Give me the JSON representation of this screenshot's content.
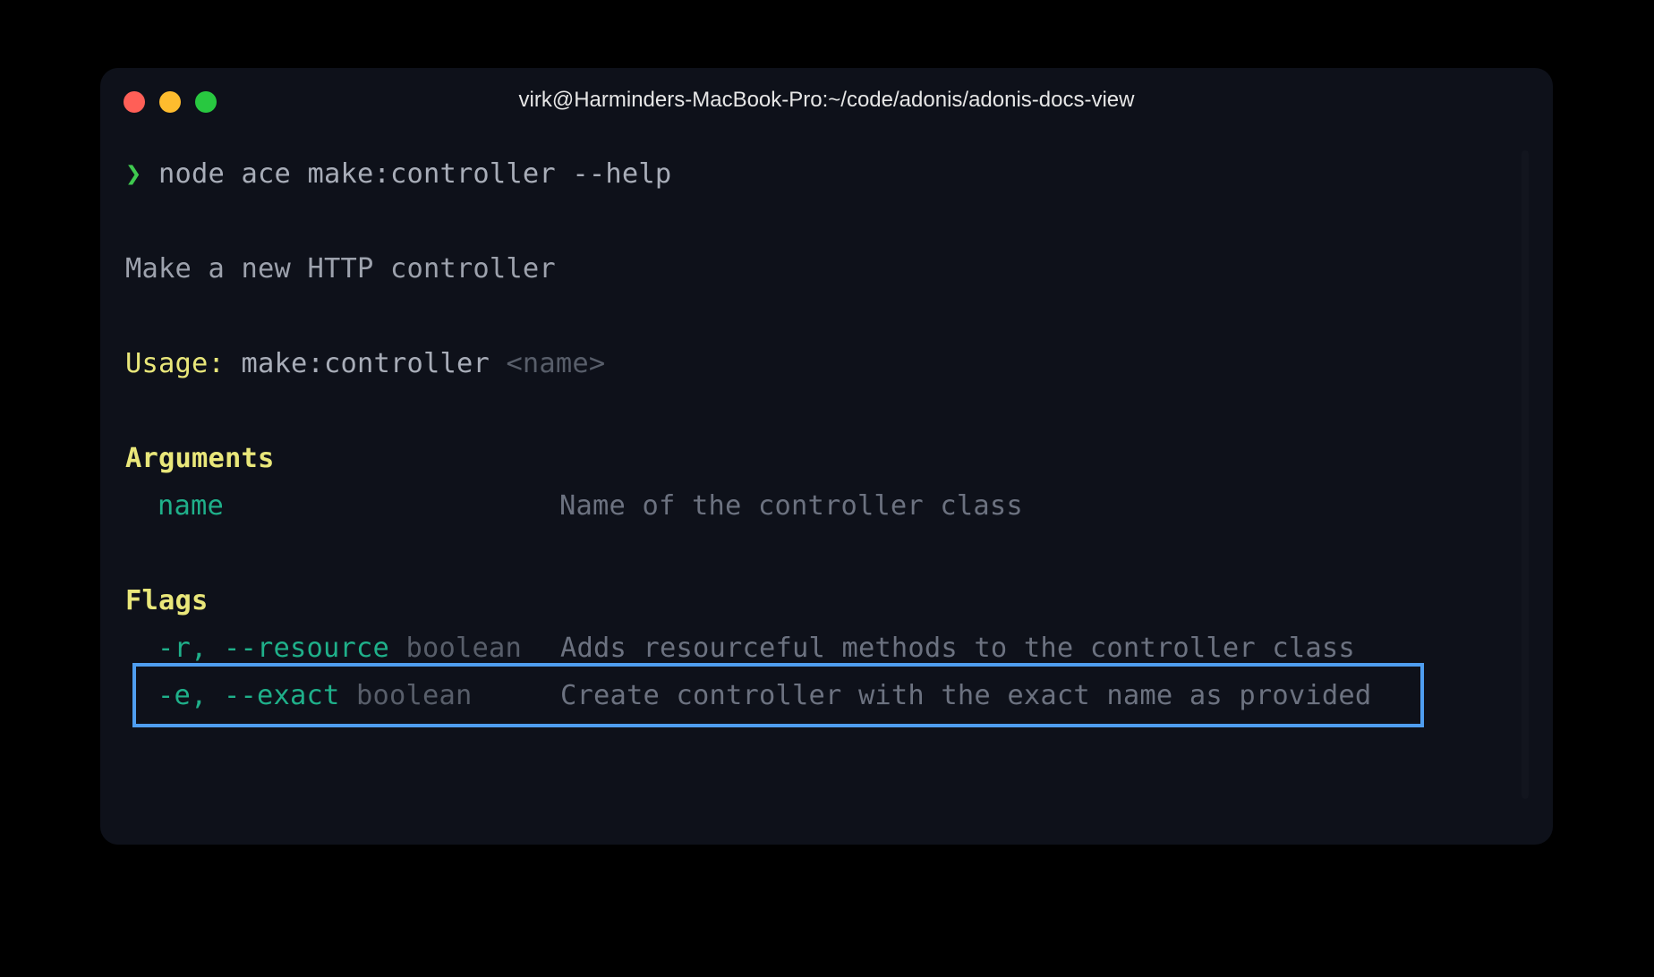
{
  "window": {
    "title": "virk@Harminders-MacBook-Pro:~/code/adonis/adonis-docs-view"
  },
  "colors": {
    "background": "#0e111a",
    "prompt": "#3fc94f",
    "heading": "#e9e77a",
    "flag": "#1fb08a",
    "highlight": "#4f9ef0"
  },
  "terminal": {
    "prompt_symbol": "❯",
    "command": "node ace make:controller --help",
    "description": "Make a new HTTP controller",
    "usage": {
      "label": "Usage:",
      "command": "make:controller",
      "arg": "<name>"
    },
    "arguments": {
      "heading": "Arguments",
      "items": [
        {
          "name": "name",
          "description": "Name of the controller class"
        }
      ]
    },
    "flags": {
      "heading": "Flags",
      "items": [
        {
          "name": "-r, --resource",
          "type": "boolean",
          "description": "Adds resourceful methods to the controller class"
        },
        {
          "name": "-e, --exact",
          "type": "boolean",
          "description": "Create controller with the exact name as provided"
        }
      ]
    }
  }
}
